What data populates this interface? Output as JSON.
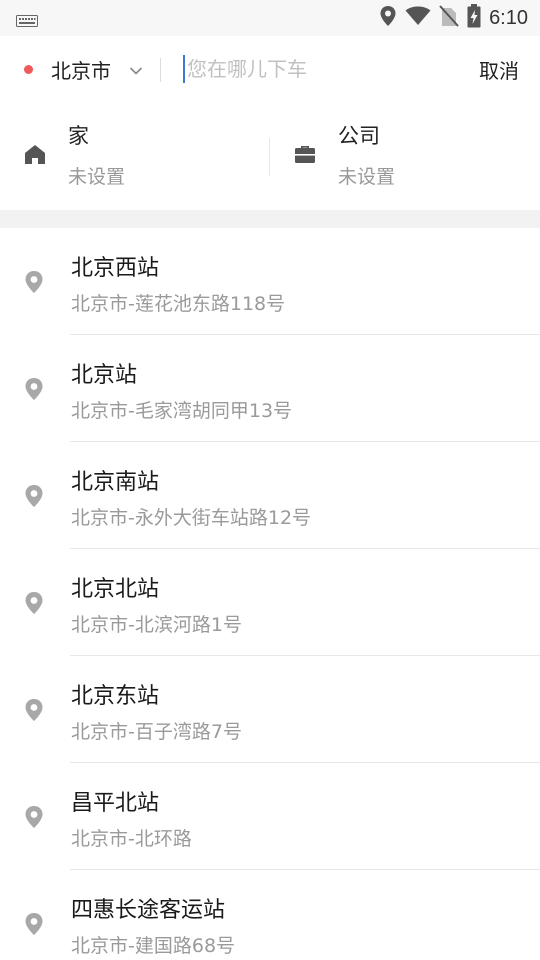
{
  "status_bar": {
    "time": "6:10",
    "icons": [
      "keyboard-icon",
      "location-icon",
      "wifi-icon",
      "no-sim-icon",
      "battery-charging-icon"
    ]
  },
  "search": {
    "city": "北京市",
    "placeholder": "您在哪儿下车",
    "value": "",
    "cancel_label": "取消",
    "city_dot_color": "#f05a5a"
  },
  "shortcuts": {
    "home": {
      "title": "家",
      "subtitle": "未设置",
      "icon": "home-icon"
    },
    "company": {
      "title": "公司",
      "subtitle": "未设置",
      "icon": "briefcase-icon"
    }
  },
  "results": [
    {
      "name": "北京西站",
      "address": "北京市-莲花池东路118号"
    },
    {
      "name": "北京站",
      "address": "北京市-毛家湾胡同甲13号"
    },
    {
      "name": "北京南站",
      "address": "北京市-永外大街车站路12号"
    },
    {
      "name": "北京北站",
      "address": "北京市-北滨河路1号"
    },
    {
      "name": "北京东站",
      "address": "北京市-百子湾路7号"
    },
    {
      "name": "昌平北站",
      "address": "北京市-北环路"
    },
    {
      "name": "四惠长途客运站",
      "address": "北京市-建国路68号"
    }
  ]
}
